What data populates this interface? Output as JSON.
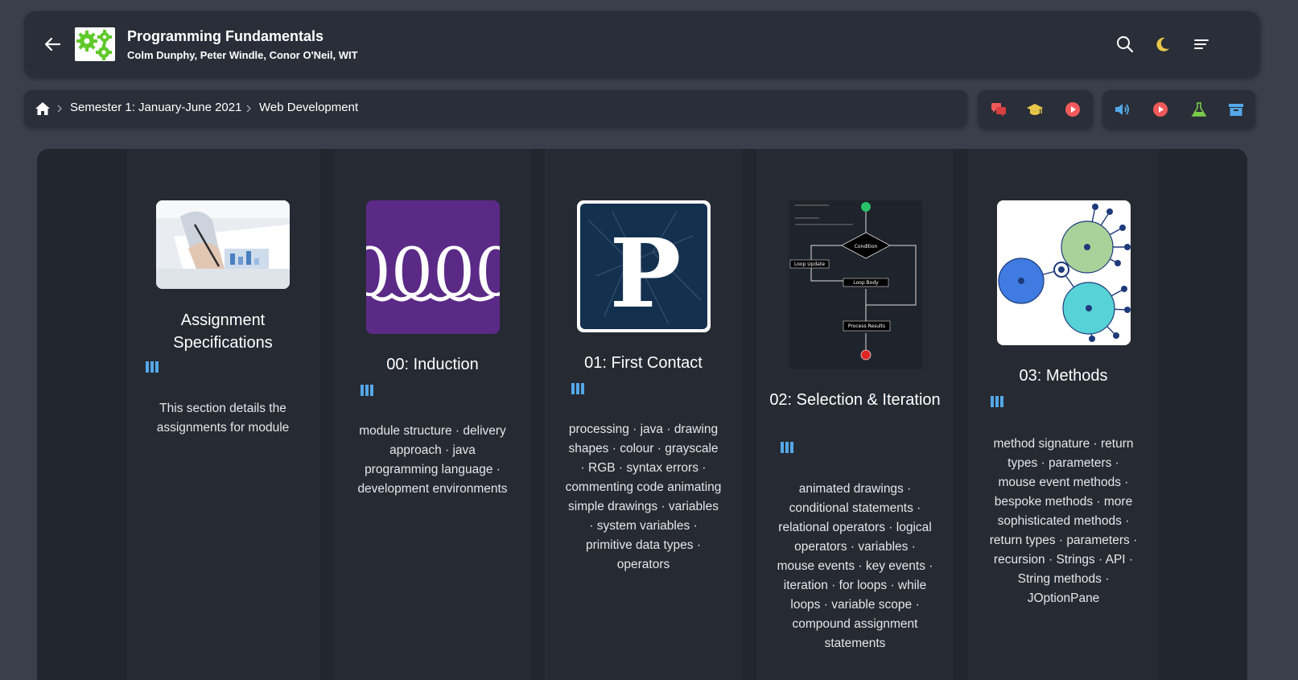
{
  "header": {
    "title": "Programming Fundamentals",
    "subtitle": "Colm Dunphy, Peter Windle, Conor O'Neil, WIT",
    "icons": [
      "back-arrow-icon",
      "gears-logo",
      "search-icon",
      "moon-icon",
      "menu-icon"
    ]
  },
  "breadcrumb": {
    "items": [
      {
        "label": "Semester 1: January-June 2021"
      },
      {
        "label": "Web Development"
      }
    ]
  },
  "toolbar_left": [
    "chat-icon",
    "graduation-cap-icon",
    "play-circle-icon"
  ],
  "toolbar_right": [
    "volume-icon",
    "play-circle-icon",
    "flask-icon",
    "archive-icon"
  ],
  "colors": {
    "accent_blue": "#54a8e8",
    "red": "#f05a5a",
    "yellow": "#e8c74a",
    "green": "#7acb4a",
    "page_bg": "#3a3f4b",
    "card_bg": "#262a33"
  },
  "cards": [
    {
      "title": "Assignment Specifications",
      "description": "This section details the assignments for module"
    },
    {
      "title": "00: Induction",
      "thumb_text": "0000",
      "description": "module structure · delivery approach · java programming language · development environments"
    },
    {
      "title": "01: First Contact",
      "thumb_text": "P",
      "description": "processing · java · drawing shapes · colour · grayscale · RGB · syntax errors · commenting code animating simple drawings · variables · system variables · primitive data types · operators"
    },
    {
      "title": "02: Selection & Iteration",
      "thumb_labels": [
        "Condition",
        "Loop Update",
        "Loop Body",
        "Process Results"
      ],
      "description": "animated drawings · conditional statements · relational operators · logical operators · variables · mouse events · key events · iteration · for loops · while loops · variable scope · compound assignment statements"
    },
    {
      "title": "03: Methods",
      "description": "method signature · return types · parameters · mouse event methods · bespoke methods · more sophisticated methods · return types · parameters · recursion · Strings · API · String methods · JOptionPane"
    }
  ]
}
